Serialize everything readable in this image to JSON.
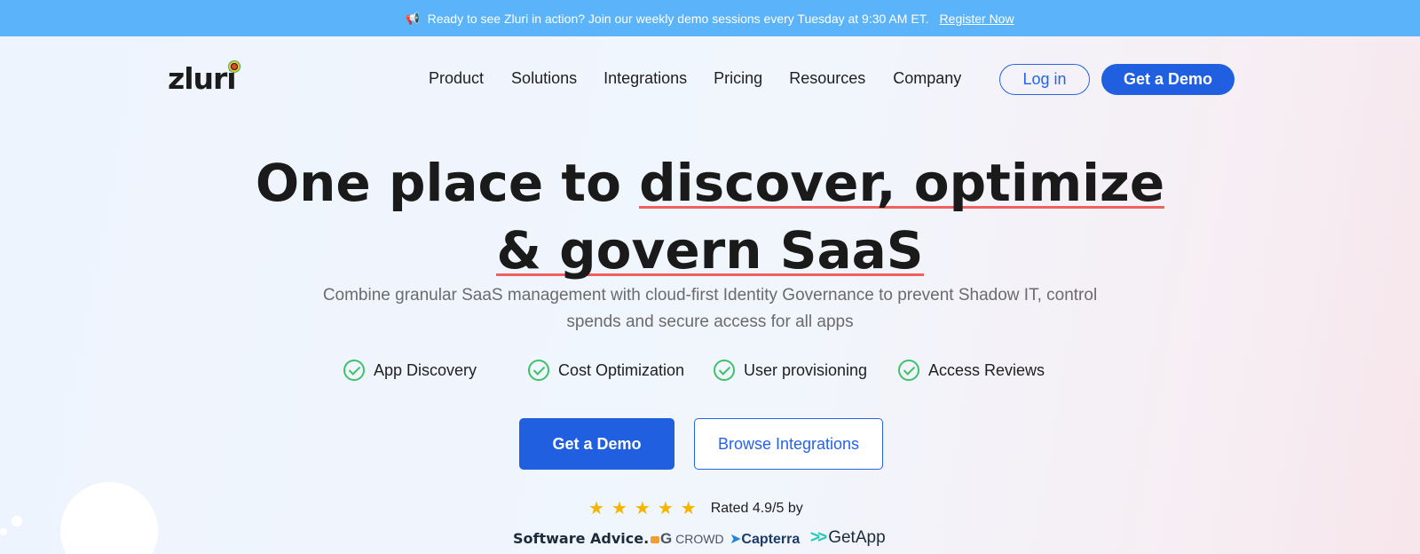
{
  "announcement": {
    "icon": "megaphone-icon",
    "text": "Ready to see Zluri in action? Join our weekly demo sessions every Tuesday at 9:30 AM ET.",
    "link": "Register Now"
  },
  "nav": {
    "logo": "zluri",
    "menu": [
      "Product",
      "Solutions",
      "Integrations",
      "Pricing",
      "Resources",
      "Company"
    ],
    "login": "Log in",
    "demo": "Get a Demo"
  },
  "hero": {
    "title_plain": "One place to ",
    "title_highlight_1": "discover, optimize",
    "title_highlight_2": "& govern SaaS",
    "subtitle": "Combine granular SaaS management with cloud-first Identity Governance to prevent Shadow IT, control spends and secure access for all apps",
    "features": [
      "App Discovery",
      "Cost Optimization",
      "User provisioning",
      "Access Reviews"
    ],
    "cta_primary": "Get a Demo",
    "cta_secondary": "Browse Integrations"
  },
  "rating": {
    "stars": 5,
    "text": "Rated 4.9/5 by",
    "sources": [
      "Software Advice.",
      "CROWD",
      "Capterra",
      "GetApp"
    ]
  },
  "colors": {
    "announcement_bg": "#5bb4f9",
    "primary": "#1f5fe0",
    "check": "#3cc26a",
    "star": "#f5b400",
    "underline": "#f06060"
  }
}
